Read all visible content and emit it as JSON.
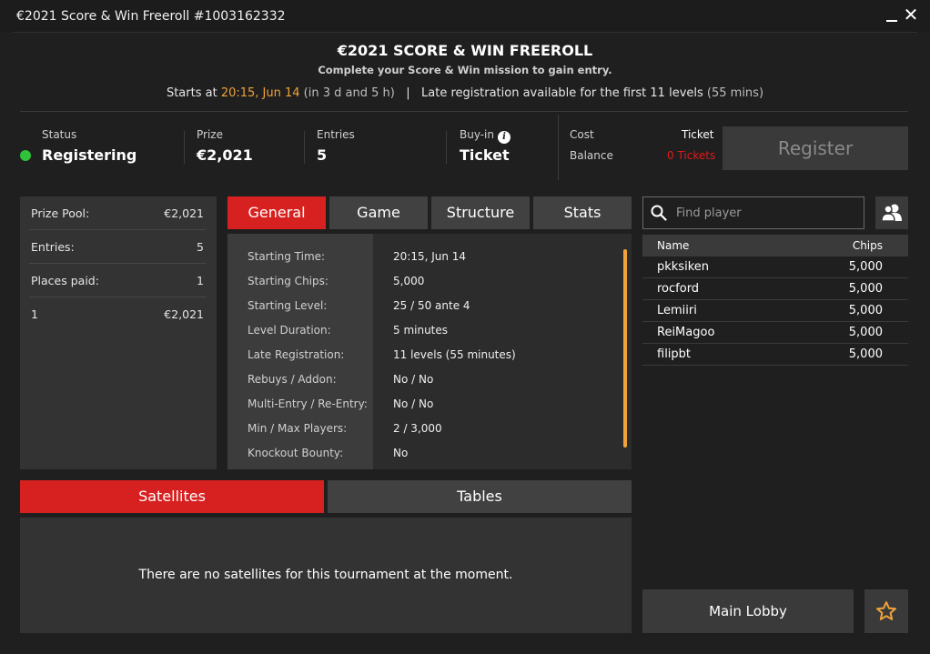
{
  "window": {
    "title": "€2021 Score & Win Freeroll #1003162332",
    "close_glyph": "✕"
  },
  "header": {
    "name": "€2021 SCORE & WIN FREEROLL",
    "subtitle": "Complete your Score & Win mission to gain entry.",
    "starts_prefix": "Starts at ",
    "starts_time": "20:15, Jun 14",
    "starts_in": " (in 3 d and 5 h)",
    "separator": "|",
    "late_reg": "Late registration available for the first 11 levels",
    "late_reg_duration": " (55 mins)"
  },
  "info": {
    "status_label": "Status",
    "status_value": "Registering",
    "prize_label": "Prize",
    "prize_value": "€2,021",
    "entries_label": "Entries",
    "entries_value": "5",
    "buyin_label": "Buy-in",
    "buyin_value": "Ticket",
    "info_glyph": "i",
    "cost_label": "Cost",
    "cost_value": "Ticket",
    "balance_label": "Balance",
    "balance_value": "0 Tickets",
    "register_label": "Register"
  },
  "prize_pool": {
    "rows": [
      {
        "label": "Prize Pool:",
        "value": "€2,021"
      },
      {
        "label": "Entries:",
        "value": "5"
      },
      {
        "label": "Places paid:",
        "value": "1"
      },
      {
        "label": "1",
        "value": "€2,021"
      }
    ]
  },
  "tabs": [
    "General",
    "Game",
    "Structure",
    "Stats"
  ],
  "general": [
    {
      "label": "Starting Time:",
      "value": "20:15, Jun 14"
    },
    {
      "label": "Starting Chips:",
      "value": "5,000"
    },
    {
      "label": "Starting Level:",
      "value": "25 / 50 ante 4"
    },
    {
      "label": "Level Duration:",
      "value": "5 minutes"
    },
    {
      "label": "Late Registration:",
      "value": "11 levels (55 minutes)"
    },
    {
      "label": "Rebuys / Addon:",
      "value": "No / No"
    },
    {
      "label": "Multi-Entry / Re-Entry:",
      "value": "No / No"
    },
    {
      "label": "Min / Max Players:",
      "value": "2 / 3,000"
    },
    {
      "label": "Knockout Bounty:",
      "value": "No"
    }
  ],
  "bottom_tabs": [
    "Satellites",
    "Tables"
  ],
  "satellites_message": "There are no satellites for this tournament at the moment.",
  "search": {
    "placeholder": "Find player"
  },
  "players": {
    "col_name": "Name",
    "col_chips": "Chips",
    "rows": [
      {
        "name": "pkksiken",
        "chips": "5,000"
      },
      {
        "name": "rocford",
        "chips": "5,000"
      },
      {
        "name": "Lemiiri",
        "chips": "5,000"
      },
      {
        "name": "ReiMagoo",
        "chips": "5,000"
      },
      {
        "name": "filipbt",
        "chips": "5,000"
      }
    ]
  },
  "main_lobby_label": "Main Lobby",
  "colors": {
    "accent_red": "#d72020",
    "accent_orange": "#f0a33a",
    "status_green": "#2fc23a",
    "balance_red": "#e11a1a"
  }
}
